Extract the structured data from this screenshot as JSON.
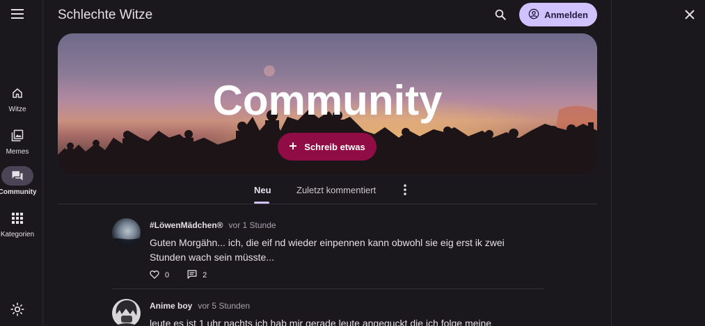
{
  "app": {
    "title": "Schlechte Witze"
  },
  "nav": {
    "items": [
      {
        "label": "Witze",
        "icon": "home-icon"
      },
      {
        "label": "Memes",
        "icon": "image-gallery-icon"
      },
      {
        "label": "Community",
        "icon": "forum-icon",
        "active": true
      },
      {
        "label": "Kategorien",
        "icon": "grid-apps-icon"
      }
    ]
  },
  "header": {
    "login_label": "Anmelden"
  },
  "hero": {
    "title": "Community",
    "write_label": "Schreib etwas"
  },
  "tabs": [
    {
      "label": "Neu",
      "active": true
    },
    {
      "label": "Zuletzt kommentiert",
      "active": false
    }
  ],
  "posts": [
    {
      "author": "#LöwenMädchen®",
      "time": "vor 1 Stunde",
      "text": "Guten Morgähn... ich, die eif nd wieder einpennen kann obwohl sie eig erst ik zwei Stunden wach sein müsste...",
      "likes": "0",
      "comments": "2"
    },
    {
      "author": "Anime boy",
      "time": "vor 5 Stunden",
      "text": "leute es ist 1 uhr nachts ich hab mir gerade leute angeguckt die ich folge meine"
    }
  ],
  "colors": {
    "accent": "#cfc2ff",
    "primary_button": "#8f0d44",
    "background": "#1a171d"
  }
}
